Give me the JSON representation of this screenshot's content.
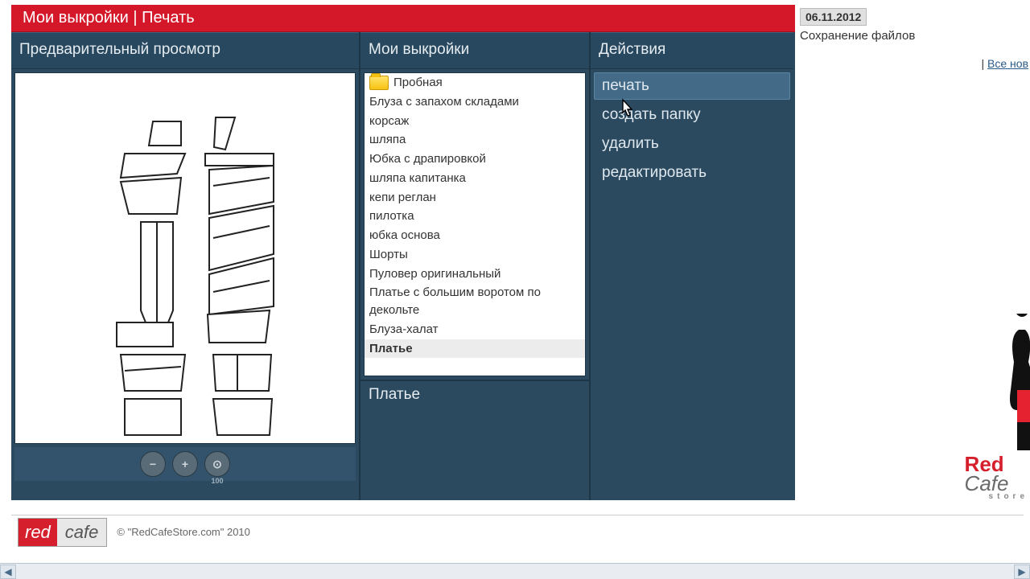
{
  "titlebar": {
    "text": "Мои выкройки | Печать"
  },
  "preview": {
    "header": "Предварительный просмотр",
    "zoom_100_label": "100"
  },
  "patterns": {
    "header": "Мои выкройки",
    "folder_label": "Пробная",
    "items": [
      "Блуза с запахом складами",
      "корсаж",
      "шляпа",
      "Юбка с драпировкой",
      "шляпа капитанка",
      "кепи реглан",
      "пилотка",
      "юбка основа",
      "Шорты",
      "Пуловер оригинальный",
      "Платье с большим воротом по декольте",
      "Блуза-халат",
      "Платье"
    ],
    "selected_index": 12,
    "detail_label": "Платье"
  },
  "actions": {
    "header": "Действия",
    "items": [
      "печать",
      "создать папку",
      "удалить",
      "редактировать"
    ],
    "hover_index": 0
  },
  "news": {
    "date": "06.11.2012",
    "title": "Сохранение файлов",
    "all_prefix": "| ",
    "all_link": "Все нов"
  },
  "footer": {
    "logo_red": "red",
    "logo_cafe": "cafe",
    "copy": "© \"RedCafeStore.com\" 2010"
  },
  "logo": {
    "red": "Red",
    "cafe": "Cafe",
    "store": "store"
  }
}
